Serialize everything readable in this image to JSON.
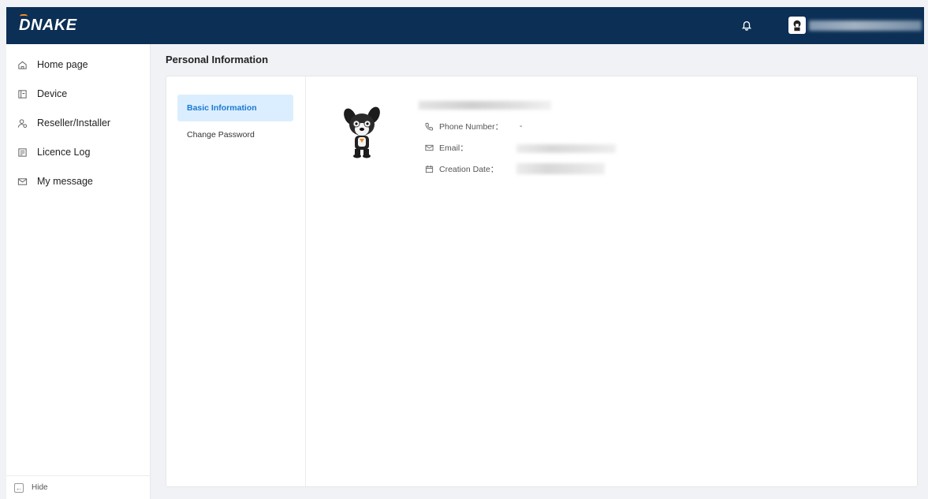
{
  "header": {
    "logo_text": "DNAKE",
    "brand_color": "#0b2f55",
    "accent_color": "#f08a24"
  },
  "sidebar": {
    "items": [
      {
        "label": "Home page",
        "icon": "home-icon"
      },
      {
        "label": "Device",
        "icon": "device-icon"
      },
      {
        "label": "Reseller/Installer",
        "icon": "user-icon"
      },
      {
        "label": "Licence Log",
        "icon": "log-icon"
      },
      {
        "label": "My message",
        "icon": "mail-icon"
      }
    ],
    "hide_label": "Hide",
    "hide_icon": "arrow-left-icon"
  },
  "main": {
    "page_title": "Personal Information",
    "subnav": [
      {
        "label": "Basic Information",
        "active": true
      },
      {
        "label": "Change Password",
        "active": false
      }
    ],
    "profile": {
      "fields": [
        {
          "label": "Phone Number：",
          "value": "-",
          "icon": "phone-icon"
        },
        {
          "label": "Email：",
          "value": "",
          "icon": "mail-icon"
        },
        {
          "label": "Creation Date：",
          "value": "",
          "icon": "calendar-icon"
        }
      ]
    }
  }
}
